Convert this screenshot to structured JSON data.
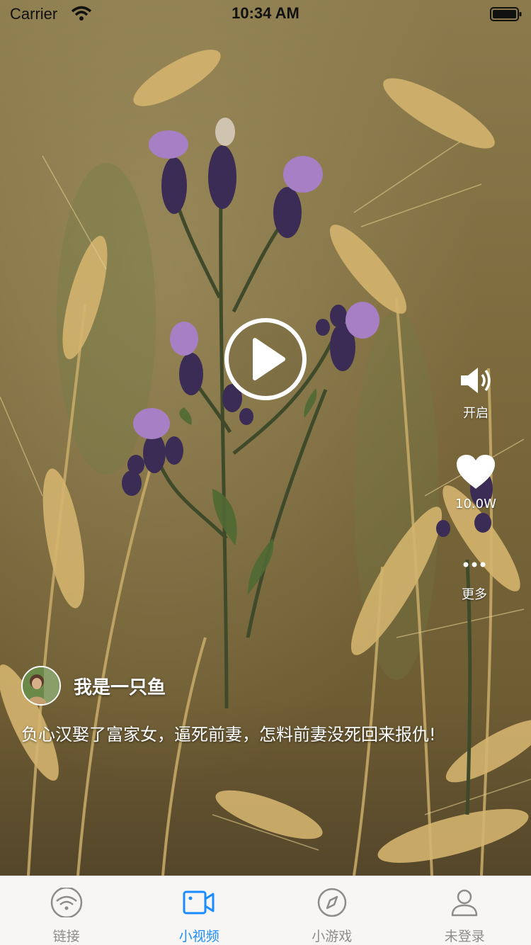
{
  "status_bar": {
    "carrier": "Carrier",
    "time": "10:34 AM"
  },
  "video": {
    "author_name": "我是一只鱼",
    "caption": "负心汉娶了富家女，逼死前妻，怎料前妻没死回来报仇!",
    "play_icon": "play-icon"
  },
  "rail": {
    "sound_label": "开启",
    "like_count": "10.0W",
    "more_label": "更多"
  },
  "tabs": [
    {
      "label": "链接",
      "icon": "wifi-icon",
      "active": false
    },
    {
      "label": "小视频",
      "icon": "video-camera-icon",
      "active": true
    },
    {
      "label": "小游戏",
      "icon": "compass-icon",
      "active": false
    },
    {
      "label": "未登录",
      "icon": "user-icon",
      "active": false
    }
  ],
  "colors": {
    "tab_active": "#1a8cff",
    "tab_inactive": "#8c8c8c",
    "tabbar_bg": "#f7f6f4"
  }
}
